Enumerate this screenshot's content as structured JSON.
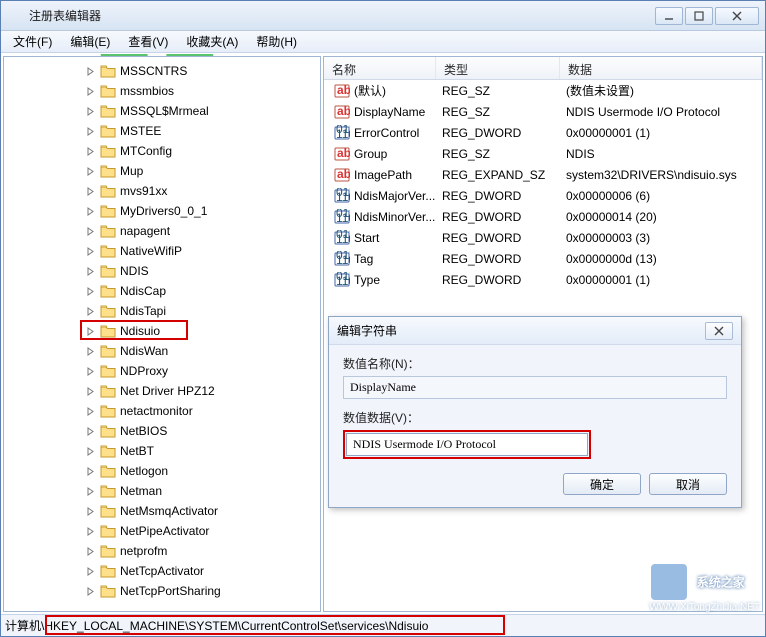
{
  "window": {
    "title": "注册表编辑器"
  },
  "menus": [
    "文件(F)",
    "编辑(E)",
    "查看(V)",
    "收藏夹(A)",
    "帮助(H)"
  ],
  "tree": {
    "items": [
      {
        "label": "MSSCNTRS"
      },
      {
        "label": "mssmbios"
      },
      {
        "label": "MSSQL$Mrmeal"
      },
      {
        "label": "MSTEE"
      },
      {
        "label": "MTConfig"
      },
      {
        "label": "Mup"
      },
      {
        "label": "mvs91xx"
      },
      {
        "label": "MyDrivers0_0_1"
      },
      {
        "label": "napagent"
      },
      {
        "label": "NativeWifiP"
      },
      {
        "label": "NDIS"
      },
      {
        "label": "NdisCap"
      },
      {
        "label": "NdisTapi"
      },
      {
        "label": "Ndisuio",
        "highlighted": true
      },
      {
        "label": "NdisWan"
      },
      {
        "label": "NDProxy"
      },
      {
        "label": "Net Driver HPZ12"
      },
      {
        "label": "netactmonitor"
      },
      {
        "label": "NetBIOS"
      },
      {
        "label": "NetBT"
      },
      {
        "label": "Netlogon"
      },
      {
        "label": "Netman"
      },
      {
        "label": "NetMsmqActivator"
      },
      {
        "label": "NetPipeActivator"
      },
      {
        "label": "netprofm"
      },
      {
        "label": "NetTcpActivator"
      },
      {
        "label": "NetTcpPortSharing"
      }
    ]
  },
  "list": {
    "columns": {
      "name": "名称",
      "type": "类型",
      "data": "数据"
    },
    "rows": [
      {
        "icon": "sz",
        "name": "(默认)",
        "type": "REG_SZ",
        "data": "(数值未设置)"
      },
      {
        "icon": "sz",
        "name": "DisplayName",
        "type": "REG_SZ",
        "data": "NDIS Usermode I/O Protocol"
      },
      {
        "icon": "bin",
        "name": "ErrorControl",
        "type": "REG_DWORD",
        "data": "0x00000001 (1)"
      },
      {
        "icon": "sz",
        "name": "Group",
        "type": "REG_SZ",
        "data": "NDIS"
      },
      {
        "icon": "sz",
        "name": "ImagePath",
        "type": "REG_EXPAND_SZ",
        "data": "system32\\DRIVERS\\ndisuio.sys"
      },
      {
        "icon": "bin",
        "name": "NdisMajorVer...",
        "type": "REG_DWORD",
        "data": "0x00000006 (6)"
      },
      {
        "icon": "bin",
        "name": "NdisMinorVer...",
        "type": "REG_DWORD",
        "data": "0x00000014 (20)"
      },
      {
        "icon": "bin",
        "name": "Start",
        "type": "REG_DWORD",
        "data": "0x00000003 (3)"
      },
      {
        "icon": "bin",
        "name": "Tag",
        "type": "REG_DWORD",
        "data": "0x0000000d (13)"
      },
      {
        "icon": "bin",
        "name": "Type",
        "type": "REG_DWORD",
        "data": "0x00000001 (1)"
      }
    ]
  },
  "dialog": {
    "title": "编辑字符串",
    "name_label": "数值名称(N)：",
    "name_value": "DisplayName",
    "data_label": "数值数据(V)：",
    "data_value": "NDIS Usermode I/O Protocol",
    "ok": "确定",
    "cancel": "取消"
  },
  "status": {
    "prefix": "计算机",
    "path": "\\HKEY_LOCAL_MACHINE\\SYSTEM\\CurrentControlSet\\services\\Ndisuio"
  },
  "watermark": {
    "text": "系统之家",
    "url": "WWW.XiTongZhiJia.NET"
  }
}
